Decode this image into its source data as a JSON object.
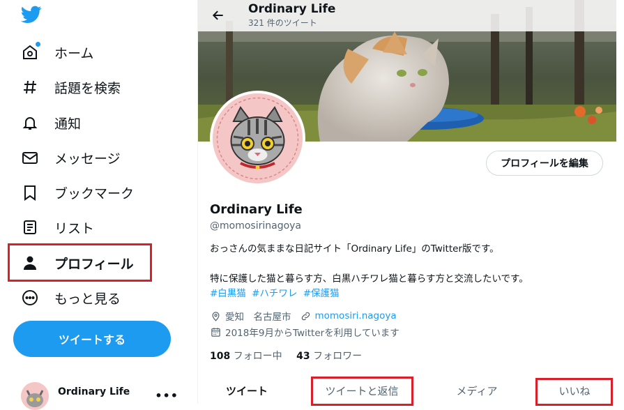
{
  "sidebar": {
    "items": [
      {
        "label": "ホーム",
        "icon": "home-icon"
      },
      {
        "label": "話題を検索",
        "icon": "hashtag-icon"
      },
      {
        "label": "通知",
        "icon": "bell-icon"
      },
      {
        "label": "メッセージ",
        "icon": "envelope-icon"
      },
      {
        "label": "ブックマーク",
        "icon": "bookmark-icon"
      },
      {
        "label": "リスト",
        "icon": "list-icon"
      },
      {
        "label": "プロフィール",
        "icon": "person-icon"
      },
      {
        "label": "もっと見る",
        "icon": "more-circle-icon"
      }
    ],
    "tweet_button": "ツイートする",
    "account": {
      "name": "Ordinary Life",
      "more": "•••"
    }
  },
  "header": {
    "title": "Ordinary Life",
    "subtitle": "321 件のツイート"
  },
  "profile": {
    "edit_button": "プロフィールを編集",
    "name": "Ordinary Life",
    "handle": "@momosirinagoya",
    "bio_line1": "おっさんの気ままな日記サイト「Ordinary Life」のTwitter版です。",
    "bio_line2": "特に保護した猫と暮らす方、白黒ハチワレ猫と暮らす方と交流したいです。",
    "hashtags": [
      "#白黒猫",
      "#ハチワレ",
      "#保護猫"
    ],
    "location": "愛知　名古屋市",
    "website": "momosiri.nagoya",
    "joined": "2018年9月からTwitterを利用しています",
    "following_count": "108",
    "following_label": "フォロー中",
    "followers_count": "43",
    "followers_label": "フォロワー"
  },
  "tabs": [
    "ツイート",
    "ツイートと返信",
    "メディア",
    "いいね"
  ],
  "colors": {
    "accent": "#1d9bf0",
    "highlight_box": "#d81f2a"
  }
}
